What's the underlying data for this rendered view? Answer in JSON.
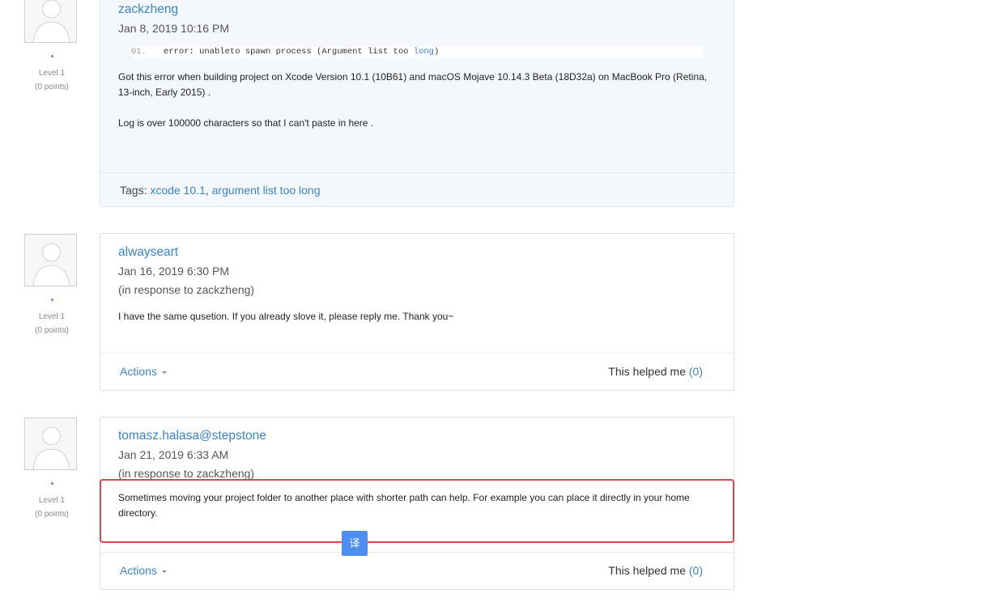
{
  "posts": [
    {
      "username": "zackzheng",
      "date": "Jan 8, 2019 10:16 PM",
      "level": "Level 1",
      "points": "(0 points)",
      "code": {
        "line_number": "01.",
        "text": "error: unableto spawn process (Argument list too ",
        "keyword": "long",
        "tail": ")"
      },
      "paragraphs": [
        "Got this error when building project on Xcode Version 10.1 (10B61) and macOS Mojave 10.14.3 Beta (18D32a) on MacBook Pro (Retina, 13-inch, Early 2015) .",
        "Log is over 100000 characters so that I can't paste in here ."
      ],
      "tags_label": "Tags:",
      "tags": [
        "xcode 10.1",
        "argument list too long"
      ],
      "tag_separator": ","
    },
    {
      "username": "alwayseart",
      "date": "Jan 16, 2019 6:30 PM",
      "reply_to": "(in response to zackzheng)",
      "level": "Level 1",
      "points": "(0 points)",
      "paragraphs": [
        "I have the same qusetion. If you already slove it, please reply me. Thank you~"
      ],
      "actions_label": "Actions",
      "helped_label": "This helped me",
      "helped_count": "(0)"
    },
    {
      "username": "tomasz.halasa@stepstone",
      "date": "Jan 21, 2019 6:33 AM",
      "reply_to": "(in response to zackzheng)",
      "level": "Level 1",
      "points": "(0 points)",
      "paragraphs": [
        "Sometimes moving your project folder to another place with shorter path can help. For example you can place it directly in your home directory."
      ],
      "actions_label": "Actions",
      "helped_label": "This helped me",
      "helped_count": "(0)"
    }
  ],
  "overlay": {
    "translate_label": "译",
    "highlight_color": "#e0454c",
    "button_color": "#4d8ef0"
  },
  "colors": {
    "link": "#3a84c6",
    "level_dot": "#7a7ad8"
  },
  "icons": {
    "avatar": "default-user-silhouette-icon",
    "caret": "caret-down-icon"
  }
}
